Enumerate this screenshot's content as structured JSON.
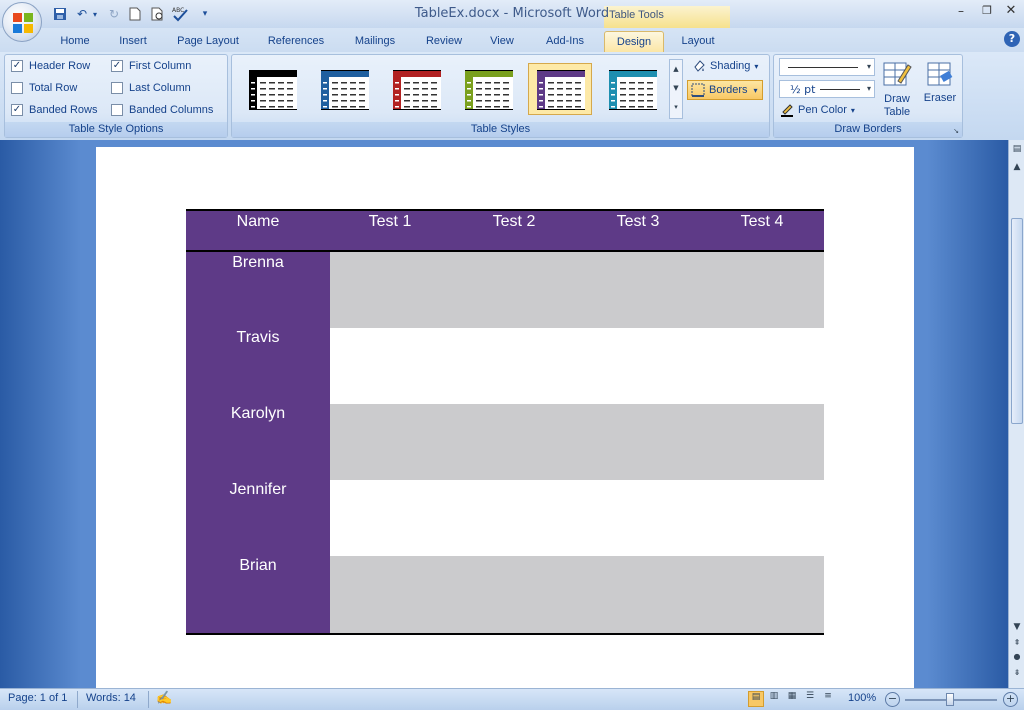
{
  "window": {
    "title": "TableEx.docx - Microsoft Word"
  },
  "context_tab": {
    "label": "Table Tools"
  },
  "tabs": [
    "Home",
    "Insert",
    "Page Layout",
    "References",
    "Mailings",
    "Review",
    "View",
    "Add-Ins",
    "Design",
    "Layout"
  ],
  "active_tab": "Design",
  "table_style_options": {
    "label": "Table Style Options",
    "options": [
      {
        "label": "Header Row",
        "checked": true
      },
      {
        "label": "First Column",
        "checked": true
      },
      {
        "label": "Total Row",
        "checked": false
      },
      {
        "label": "Last Column",
        "checked": false
      },
      {
        "label": "Banded Rows",
        "checked": true
      },
      {
        "label": "Banded Columns",
        "checked": false
      }
    ]
  },
  "table_styles": {
    "label": "Table Styles",
    "gallery_colors": [
      "#000000",
      "#1f5f9f",
      "#b22222",
      "#7aa01d",
      "#5e3a87",
      "#1e8fb0"
    ],
    "selected_index": 4,
    "shading_label": "Shading",
    "borders_label": "Borders"
  },
  "draw_borders": {
    "label": "Draw Borders",
    "pen_weight": "½ pt",
    "pen_color_label": "Pen Color",
    "draw_table_label": "Draw Table",
    "eraser_label": "Eraser"
  },
  "document_table": {
    "header_color": "#5e3a87",
    "band_color": "#cbcbcd",
    "headers": [
      "Name",
      "Test 1",
      "Test 2",
      "Test 3",
      "Test 4"
    ],
    "names": [
      "Brenna",
      "Travis",
      "Karolyn",
      "Jennifer",
      "Brian"
    ]
  },
  "status": {
    "page": "Page: 1 of 1",
    "words": "Words: 14",
    "zoom": "100%"
  }
}
